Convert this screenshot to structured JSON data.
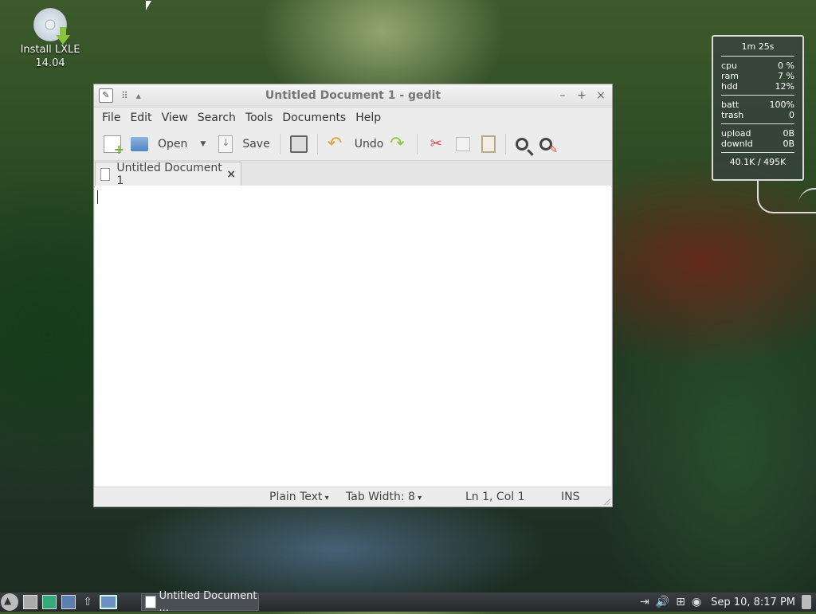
{
  "desktop": {
    "icon_label": "Install LXLE 14.04"
  },
  "conky": {
    "uptime": "1m 25s",
    "stats": [
      {
        "label": "cpu",
        "value": "0 %"
      },
      {
        "label": "ram",
        "value": "7 %"
      },
      {
        "label": "hdd",
        "value": "12%"
      }
    ],
    "stats2": [
      {
        "label": "batt",
        "value": "100%"
      },
      {
        "label": "trash",
        "value": "0"
      }
    ],
    "net": [
      {
        "label": "upload",
        "value": "0B"
      },
      {
        "label": "downld",
        "value": "0B"
      }
    ],
    "total": "40.1K / 495K"
  },
  "window": {
    "title": "Untitled Document 1 - gedit",
    "menu": [
      "File",
      "Edit",
      "View",
      "Search",
      "Tools",
      "Documents",
      "Help"
    ],
    "toolbar": {
      "open": "Open",
      "save": "Save",
      "undo": "Undo"
    },
    "tab": {
      "label": "Untitled Document 1",
      "close": "×"
    },
    "statusbar": {
      "language": "Plain Text",
      "tab_width": "Tab Width: 8",
      "position": "Ln 1, Col 1",
      "mode": "INS"
    }
  },
  "taskbar": {
    "task_label": "Untitled Document ...",
    "clock": "Sep 10,  8:17 PM"
  }
}
